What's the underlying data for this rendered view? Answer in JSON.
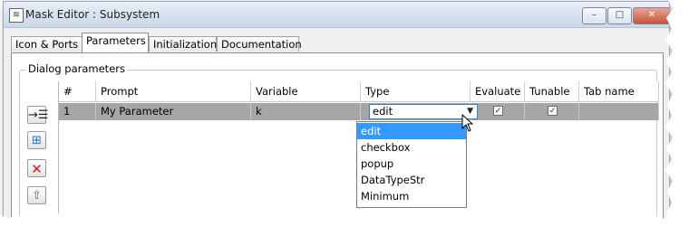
{
  "window": {
    "title": "Mask Editor : Subsystem",
    "controls": {
      "minimize": "–",
      "maximize": "□",
      "close": "✕"
    }
  },
  "tabs": [
    {
      "label": "Icon & Ports",
      "active": false
    },
    {
      "label": "Parameters",
      "active": true
    },
    {
      "label": "Initialization",
      "active": false
    },
    {
      "label": "Documentation",
      "active": false
    }
  ],
  "dialog_parameters": {
    "group_label": "Dialog parameters",
    "side_buttons": [
      {
        "icon": "insert-row-icon"
      },
      {
        "icon": "add-parameter-icon"
      },
      {
        "icon": "delete-icon"
      },
      {
        "icon": "move-up-icon"
      }
    ],
    "columns": [
      "#",
      "Prompt",
      "Variable",
      "Type",
      "Evaluate",
      "Tunable",
      "Tab name"
    ],
    "rows": [
      {
        "index": "1",
        "prompt": "My Parameter",
        "variable": "k",
        "type": "edit",
        "evaluate": true,
        "tunable": true,
        "tab_name": ""
      }
    ]
  },
  "type_dropdown": {
    "options": [
      "edit",
      "checkbox",
      "popup",
      "DataTypeStr",
      "Minimum"
    ],
    "selected": "edit"
  },
  "colors": {
    "selection": "#3399ff",
    "row_highlight": "#a6a6a6"
  }
}
